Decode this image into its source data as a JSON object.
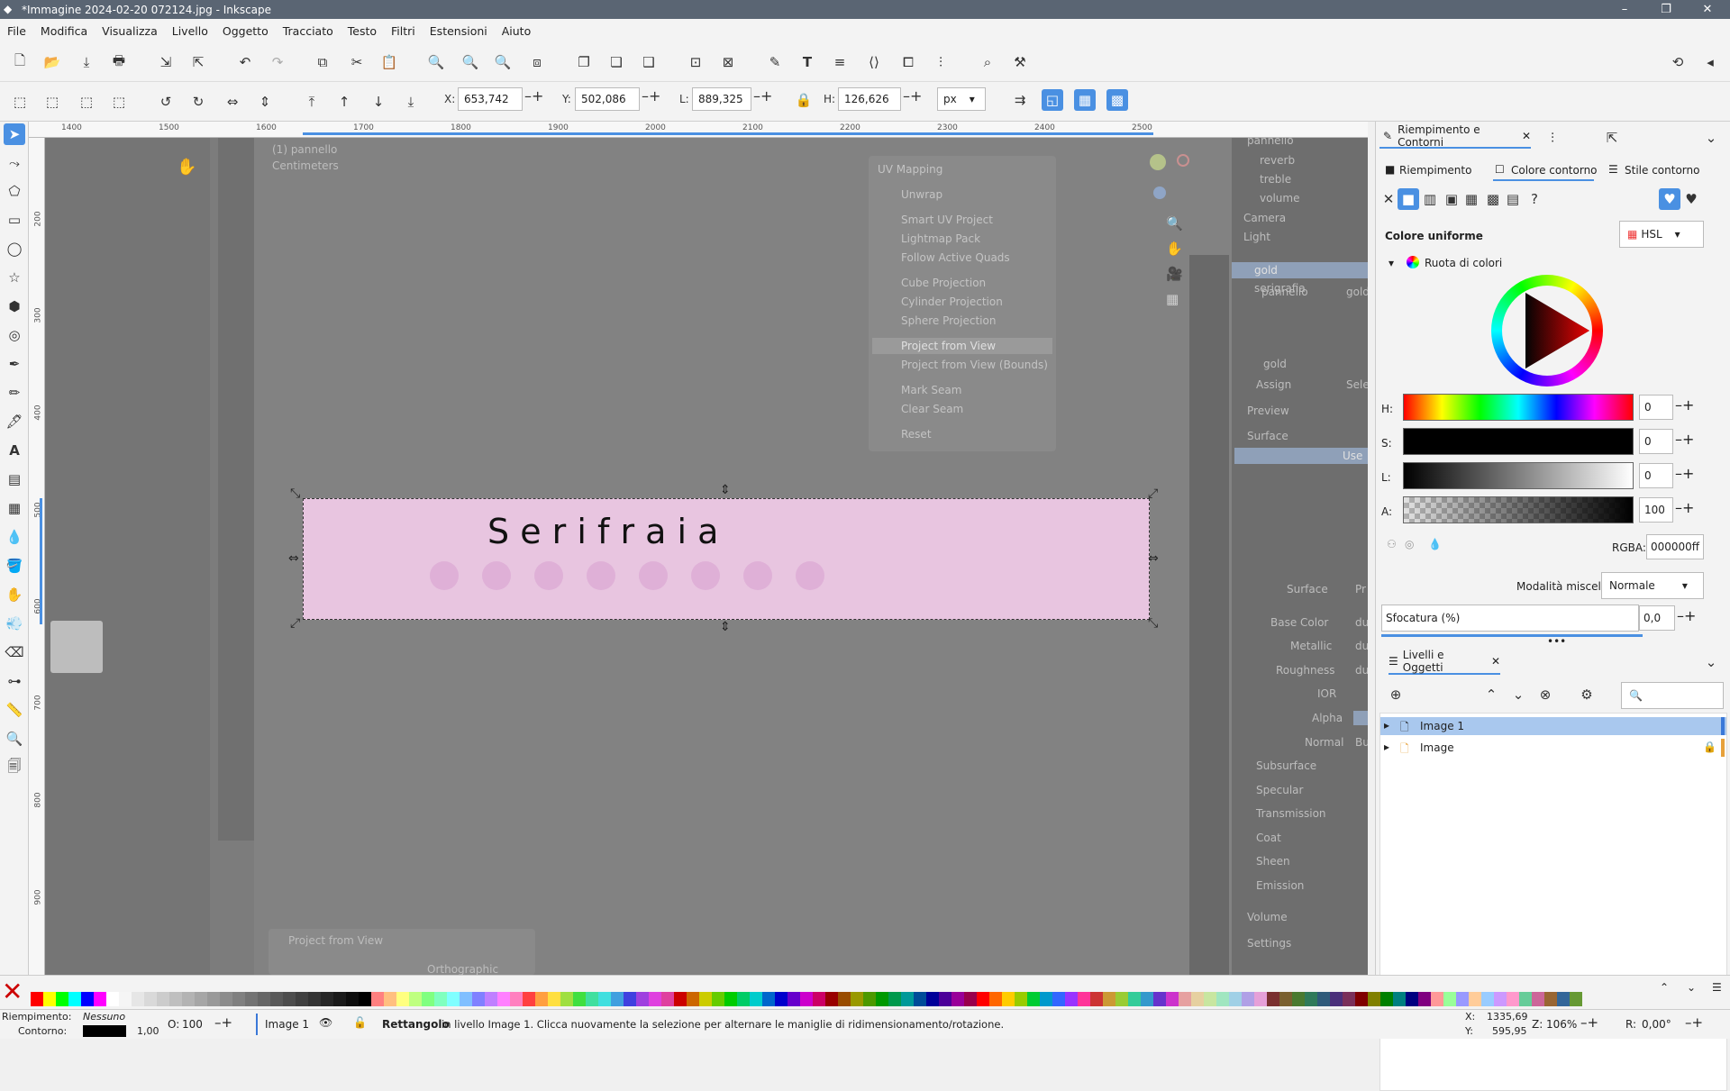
{
  "window": {
    "title": "*Immagine 2024-02-20 072124.jpg - Inkscape",
    "controls": [
      "–",
      "❐",
      "✕"
    ]
  },
  "menu": [
    "File",
    "Modifica",
    "Visualizza",
    "Livello",
    "Oggetto",
    "Tracciato",
    "Testo",
    "Filtri",
    "Estensioni",
    "Aiuto"
  ],
  "toolctrl": {
    "x_label": "X:",
    "x": "653,742",
    "y_label": "Y:",
    "y": "502,086",
    "w_label": "L:",
    "w": "889,325",
    "h_label": "H:",
    "h": "126,626",
    "unit": "px"
  },
  "ruler": {
    "top": [
      "1400",
      "1500",
      "1600",
      "1700",
      "1800",
      "1900",
      "2000",
      "2100",
      "2200",
      "2300",
      "2400",
      "2500"
    ],
    "left": [
      "200",
      "300",
      "400",
      "500",
      "600",
      "700",
      "800",
      "900"
    ]
  },
  "canvas": {
    "header_line1": "(1) pannello",
    "header_line2": "Centimeters",
    "uv_title": "UV Mapping",
    "uv_items": [
      "Unwrap",
      "Smart UV Project",
      "Lightmap Pack",
      "Follow Active Quads",
      "Cube Projection",
      "Cylinder Projection",
      "Sphere Projection",
      "Project from View",
      "Project from View (Bounds)",
      "Mark Seam",
      "Clear Seam",
      "Reset"
    ],
    "outliner": [
      "pannello",
      "reverb",
      "treble",
      "volume",
      "Camera",
      "Light"
    ],
    "breadcrumb": [
      "pannello",
      "gold"
    ],
    "materials": [
      "gold",
      "serigrafia"
    ],
    "material_name": "gold",
    "buttons": [
      "Assign",
      "Sele"
    ],
    "sections": [
      "Preview",
      "Surface"
    ],
    "use_label": "Use",
    "surface_label": "Surface",
    "props": [
      "Base Color",
      "Metallic",
      "Roughness",
      "IOR",
      "Alpha",
      "Normal",
      "Subsurface",
      "Specular",
      "Transmission",
      "Coat",
      "Sheen",
      "Emission"
    ],
    "prop_values": [
      "Pr",
      "du",
      "du",
      "du",
      "Bu"
    ],
    "bottom_sections": [
      "Volume",
      "Settings"
    ],
    "redo_panel": "Project from View",
    "redo_option": "Orthographic",
    "banner_text": "S e r i f r a i a"
  },
  "fill_stroke": {
    "tab": "Riempimento e Contorni",
    "subtabs": [
      "Riempimento",
      "Colore contorno",
      "Stile contorno"
    ],
    "flat_label": "Colore uniforme",
    "mode": "HSL",
    "wheel_label": "Ruota di colori",
    "sliders": [
      {
        "label": "H:",
        "value": "0"
      },
      {
        "label": "S:",
        "value": "0"
      },
      {
        "label": "L:",
        "value": "0"
      },
      {
        "label": "A:",
        "value": "100"
      }
    ],
    "rgba_label": "RGBA:",
    "rgba": "000000ff",
    "blend_label": "Modalità miscela:",
    "blend": "Normale",
    "blur_label": "Sfocatura (%)",
    "blur": "0,0"
  },
  "layers": {
    "tab": "Livelli e Oggetti",
    "items": [
      {
        "name": "Image 1",
        "selected": true
      },
      {
        "name": "Image",
        "locked": true
      }
    ]
  },
  "status": {
    "fill_label": "Riempimento:",
    "fill_value": "Nessuno",
    "stroke_label": "Contorno:",
    "stroke_width": "1,00",
    "opacity_label": "O:",
    "opacity": "100",
    "layer": "Image 1",
    "message_bold": "Rettangolo",
    "message": "in livello Image 1. Clicca nuovamente la selezione per alternare le maniglie di ridimensionamento/rotazione.",
    "cx_label": "X:",
    "cx": "1335,69",
    "cy_label": "Y:",
    "cy": "595,95",
    "zoom_label": "Z:",
    "zoom": "106%",
    "rot_label": "R:",
    "rot": "0,00°"
  },
  "palette": [
    "#ff0000",
    "#ffff00",
    "#00ff00",
    "#00ffff",
    "#0000ff",
    "#ff00ff",
    "#ffffff",
    "#f5f5f5",
    "#e6e6e6",
    "#d9d9d9",
    "#cccccc",
    "#bfbfbf",
    "#b3b3b3",
    "#a6a6a6",
    "#999999",
    "#8c8c8c",
    "#808080",
    "#737373",
    "#666666",
    "#595959",
    "#4d4d4d",
    "#404040",
    "#333333",
    "#262626",
    "#1a1a1a",
    "#0d0d0d",
    "#000000",
    "#ff8080",
    "#ffbf80",
    "#ffff80",
    "#bfff80",
    "#80ff80",
    "#80ffbf",
    "#80ffff",
    "#80bfff",
    "#8080ff",
    "#bf80ff",
    "#ff80ff",
    "#ff80bf",
    "#ff4040",
    "#ff9f40",
    "#ffdf40",
    "#9fdf40",
    "#40df40",
    "#40df9f",
    "#40dfdf",
    "#409fdf",
    "#4040df",
    "#9f40df",
    "#df40df",
    "#df409f",
    "#cc0000",
    "#cc6600",
    "#cccc00",
    "#66cc00",
    "#00cc00",
    "#00cc66",
    "#00cccc",
    "#0066cc",
    "#0000cc",
    "#6600cc",
    "#cc00cc",
    "#cc0066",
    "#990000",
    "#994c00",
    "#999900",
    "#4c9900",
    "#009900",
    "#00994c",
    "#009999",
    "#004c99",
    "#000099",
    "#4c0099",
    "#990099",
    "#99004c",
    "#ff0000",
    "#ff6600",
    "#ffcc00",
    "#99cc00",
    "#00cc33",
    "#0099cc",
    "#3366ff",
    "#9933ff",
    "#ff3399",
    "#cc3333",
    "#cc9933",
    "#99cc33",
    "#33cc99",
    "#3399cc",
    "#6633cc",
    "#cc33cc",
    "#e6a0a0",
    "#e6d0a0",
    "#c8e6a0",
    "#a0e6c0",
    "#a0d0e6",
    "#b0a0e6",
    "#e6a0d8",
    "#7a3030",
    "#7a6030",
    "#4a7a30",
    "#307a5a",
    "#305a7a",
    "#4a307a",
    "#7a305a",
    "#800000",
    "#808000",
    "#008000",
    "#008080",
    "#000080",
    "#800080",
    "#ff9999",
    "#99ff99",
    "#9999ff",
    "#ffcc99",
    "#99ccff",
    "#cc99ff",
    "#ff99cc",
    "#66cc99",
    "#cc6699",
    "#996633",
    "#336699",
    "#669933"
  ]
}
